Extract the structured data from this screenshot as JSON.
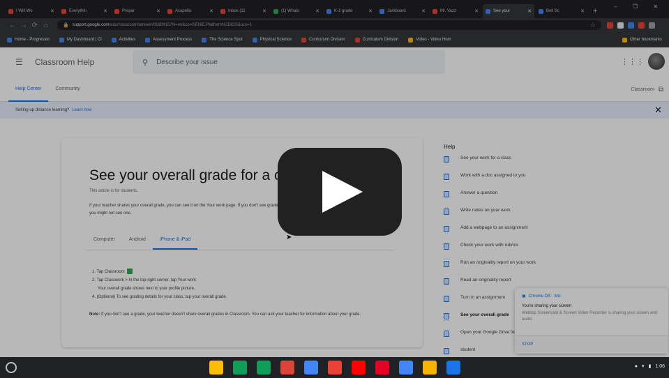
{
  "browser": {
    "tabs": [
      {
        "label": "I Will Wo",
        "color": "#ea4335"
      },
      {
        "label": "Everythin",
        "color": "#ea4335"
      },
      {
        "label": "Prepar",
        "color": "#ea4335"
      },
      {
        "label": "Acapella",
        "color": "#ea4335"
      },
      {
        "label": "Inbox (11",
        "color": "#ea4335"
      },
      {
        "label": "(1) Whats",
        "color": "#34a853"
      },
      {
        "label": "K-2 grade",
        "color": "#4285f4"
      },
      {
        "label": "Jamboard",
        "color": "#4285f4"
      },
      {
        "label": "Mr. Vazz",
        "color": "#ea4335"
      },
      {
        "label": "See your",
        "color": "#4285f4",
        "active": true
      },
      {
        "label": "Bell Sc",
        "color": "#4285f4"
      }
    ],
    "url": "support.google.com",
    "url_path": "/edu/classroom/answer/9180915?hl=en&co=GENIE.Platform%3DiOS&oco=1",
    "bookmarks": [
      {
        "label": "Home - Progressio",
        "color": "#4285f4"
      },
      {
        "label": "My Dashboard | Cl",
        "color": "#4285f4"
      },
      {
        "label": "Activities",
        "color": "#4285f4"
      },
      {
        "label": "Assessment Process",
        "color": "#4285f4"
      },
      {
        "label": "The Science Spot",
        "color": "#4285f4"
      },
      {
        "label": "Physical Science",
        "color": "#4285f4"
      },
      {
        "label": "Curriculum Division",
        "color": "#ea4335"
      },
      {
        "label": "Curriculum Division",
        "color": "#ea4335"
      },
      {
        "label": "Video - Video Hom",
        "color": "#fbbc04"
      }
    ],
    "other_bookmarks": "Other bookmarks"
  },
  "header": {
    "title": "Classroom Help",
    "search_placeholder": "Describe your issue"
  },
  "nav": {
    "tabs": [
      "Help Center",
      "Community"
    ],
    "classroom_link": "Classroom"
  },
  "banner": {
    "text": "Setting up distance learning?",
    "link": "Learn how"
  },
  "article": {
    "title": "See your overall grade for a class",
    "intro": "This article is for students.",
    "paragraph": "If your teacher shares your overall grade, you can see it on the Your work page. If you don't see grades, as you might not see one.",
    "platform_tabs": [
      "Computer",
      "Android",
      "iPhone & iPad"
    ],
    "selected_tab": "iPhone & iPad",
    "steps": [
      "1. Tap Classroom",
      "2. Tap Classwork  >  In the top-right corner, tap Your work",
      "Your overall grade shows next to your profile picture.",
      "4. (Optional) To see grading details for your class, tap your overall grade."
    ],
    "note_label": "Note:",
    "note": "If you don't see a grade, your teacher doesn't share overall grades in Classroom. You can ask your teacher for information about your grade."
  },
  "sidebar": {
    "title": "Help",
    "items": [
      "See your work for a class",
      "Work with a doc assigned to you",
      "Answer a question",
      "Write notes on your work",
      "Add a webpage to an assignment",
      "Check your work with rubrics",
      "Run an originality report on your work",
      "Read an originality report",
      "Turn in an assignment",
      "See your overall grade",
      "Open your Google Drive folder",
      "student"
    ],
    "current_item": "See your overall grade"
  },
  "share_popup": {
    "top": "Chrome OS · Mic",
    "title": "You're sharing your screen",
    "desc": "Webtop Screencast & Screen Video Recorder is sharing your screen and audio",
    "stop": "STOP"
  },
  "taskbar": {
    "apps": [
      {
        "name": "keep-icon",
        "color": "#fbbc04"
      },
      {
        "name": "sheets-icon",
        "color": "#0f9d58"
      },
      {
        "name": "classroom-icon",
        "color": "#0f9d58"
      },
      {
        "name": "pdf-icon",
        "color": "#db4437"
      },
      {
        "name": "docs-icon",
        "color": "#4285f4"
      },
      {
        "name": "gmail-icon",
        "color": "#ea4335"
      },
      {
        "name": "youtube-icon",
        "color": "#ff0000"
      },
      {
        "name": "pinterest-icon",
        "color": "#e60023"
      },
      {
        "name": "chrome-icon",
        "color": "#4285f4"
      },
      {
        "name": "slides-icon",
        "color": "#f4b400"
      },
      {
        "name": "files-icon",
        "color": "#1a73e8"
      }
    ],
    "time": "1:06"
  }
}
